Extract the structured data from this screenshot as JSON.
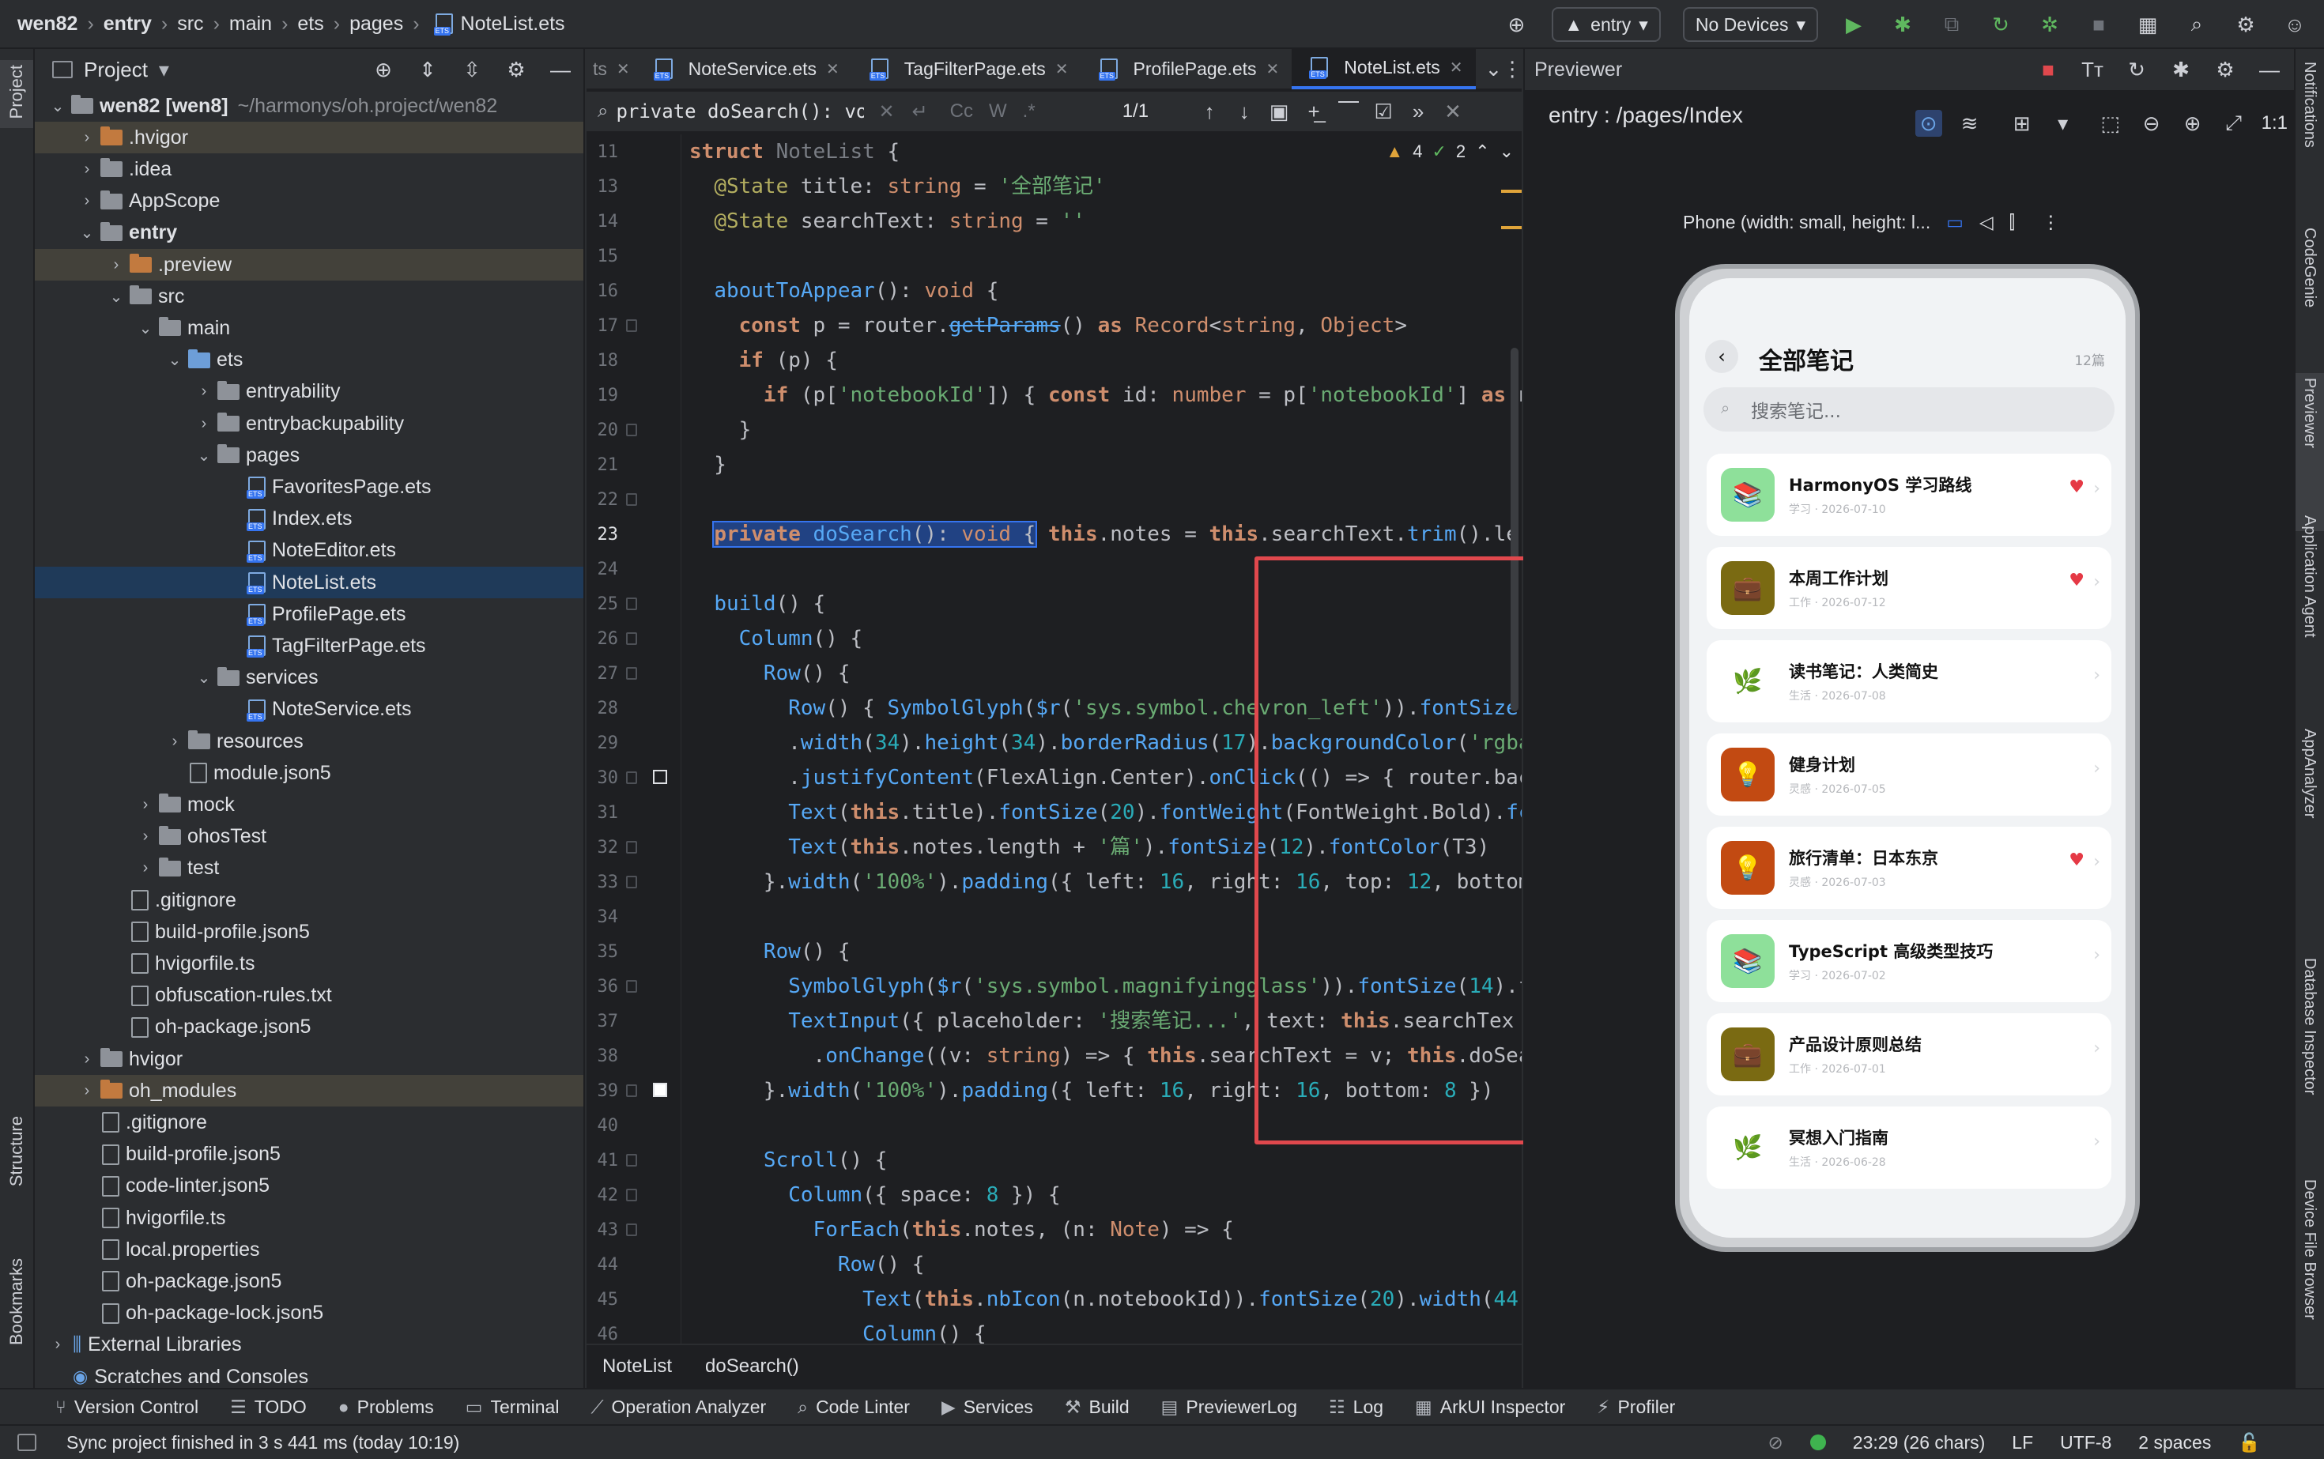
{
  "titlebar": {
    "project": "wen82",
    "path": [
      "entry",
      "src",
      "main",
      "ets",
      "pages"
    ],
    "file": "NoteList.ets",
    "run_config": "entry",
    "device": "No Devices"
  },
  "left_strip": {
    "project": "Project",
    "structure": "Structure",
    "bookmarks": "Bookmarks"
  },
  "project_panel": {
    "title": "Project",
    "items": [
      {
        "label": "wen82 [wen8]",
        "extra": "~/harmonys/oh.project/wen82",
        "depth": 0,
        "kind": "folder",
        "open": true
      },
      {
        "label": ".hvigor",
        "depth": 1,
        "kind": "folder-o",
        "open": false,
        "hl": true
      },
      {
        "label": ".idea",
        "depth": 1,
        "kind": "folder",
        "open": false
      },
      {
        "label": "AppScope",
        "depth": 1,
        "kind": "folder",
        "open": false
      },
      {
        "label": "entry",
        "depth": 1,
        "kind": "folder",
        "open": true,
        "bold": true
      },
      {
        "label": ".preview",
        "depth": 2,
        "kind": "folder-o",
        "open": false,
        "hl": true
      },
      {
        "label": "src",
        "depth": 2,
        "kind": "folder",
        "open": true
      },
      {
        "label": "main",
        "depth": 3,
        "kind": "folder",
        "open": true
      },
      {
        "label": "ets",
        "depth": 4,
        "kind": "folder-b",
        "open": true
      },
      {
        "label": "entryability",
        "depth": 5,
        "kind": "folder",
        "open": false
      },
      {
        "label": "entrybackupability",
        "depth": 5,
        "kind": "folder",
        "open": false
      },
      {
        "label": "pages",
        "depth": 5,
        "kind": "folder",
        "open": true
      },
      {
        "label": "FavoritesPage.ets",
        "depth": 6,
        "kind": "ets"
      },
      {
        "label": "Index.ets",
        "depth": 6,
        "kind": "ets"
      },
      {
        "label": "NoteEditor.ets",
        "depth": 6,
        "kind": "ets"
      },
      {
        "label": "NoteList.ets",
        "depth": 6,
        "kind": "ets",
        "sel": true
      },
      {
        "label": "ProfilePage.ets",
        "depth": 6,
        "kind": "ets"
      },
      {
        "label": "TagFilterPage.ets",
        "depth": 6,
        "kind": "ets"
      },
      {
        "label": "services",
        "depth": 5,
        "kind": "folder",
        "open": true
      },
      {
        "label": "NoteService.ets",
        "depth": 6,
        "kind": "ets"
      },
      {
        "label": "resources",
        "depth": 4,
        "kind": "folder",
        "open": false
      },
      {
        "label": "module.json5",
        "depth": 4,
        "kind": "file"
      },
      {
        "label": "mock",
        "depth": 3,
        "kind": "folder",
        "open": false
      },
      {
        "label": "ohosTest",
        "depth": 3,
        "kind": "folder",
        "open": false
      },
      {
        "label": "test",
        "depth": 3,
        "kind": "folder",
        "open": false
      },
      {
        "label": ".gitignore",
        "depth": 2,
        "kind": "file"
      },
      {
        "label": "build-profile.json5",
        "depth": 2,
        "kind": "file"
      },
      {
        "label": "hvigorfile.ts",
        "depth": 2,
        "kind": "file"
      },
      {
        "label": "obfuscation-rules.txt",
        "depth": 2,
        "kind": "file"
      },
      {
        "label": "oh-package.json5",
        "depth": 2,
        "kind": "file"
      },
      {
        "label": "hvigor",
        "depth": 1,
        "kind": "folder",
        "open": false
      },
      {
        "label": "oh_modules",
        "depth": 1,
        "kind": "folder-o",
        "open": false,
        "hl": true
      },
      {
        "label": ".gitignore",
        "depth": 1,
        "kind": "file"
      },
      {
        "label": "build-profile.json5",
        "depth": 1,
        "kind": "file"
      },
      {
        "label": "code-linter.json5",
        "depth": 1,
        "kind": "file"
      },
      {
        "label": "hvigorfile.ts",
        "depth": 1,
        "kind": "file"
      },
      {
        "label": "local.properties",
        "depth": 1,
        "kind": "file"
      },
      {
        "label": "oh-package.json5",
        "depth": 1,
        "kind": "file"
      },
      {
        "label": "oh-package-lock.json5",
        "depth": 1,
        "kind": "file"
      },
      {
        "label": "External Libraries",
        "depth": 0,
        "kind": "lib",
        "open": false
      },
      {
        "label": "Scratches and Consoles",
        "depth": 0,
        "kind": "scratch"
      }
    ]
  },
  "tabs": [
    {
      "label": "NoteService.ets",
      "active": false
    },
    {
      "label": "TagFilterPage.ets",
      "active": false
    },
    {
      "label": "ProfilePage.ets",
      "active": false
    },
    {
      "label": "NoteList.ets",
      "active": true
    }
  ],
  "tabs_truncated": "ts",
  "search": {
    "query": "private doSearch(): void {",
    "cc": "Cc",
    "w": "W",
    "star": ".*",
    "result": "1/1"
  },
  "inspection": {
    "warnings": "4",
    "checks": "2"
  },
  "code_lines": [
    {
      "n": "11",
      "h": "<span class='kw'>struct</span> <span class='dim'>NoteList</span> {"
    },
    {
      "n": "13",
      "h": "  <span class='anno'>@State</span> title: <span class='kw2'>string</span> = <span class='str'>'全部笔记'</span>"
    },
    {
      "n": "14",
      "h": "  <span class='anno'>@State</span> searchText: <span class='kw2'>string</span> = <span class='str'>''</span>"
    },
    {
      "n": "15",
      "h": ""
    },
    {
      "n": "16",
      "h": "  <span class='fn'>aboutToAppear</span>(): <span class='kw2'>void</span> {"
    },
    {
      "n": "17",
      "h": "    <span class='kw'>const</span> p = router.<span class='fn' style='text-decoration:line-through'>getParams</span>() <span class='kw'>as</span> <span class='kw2'>Record</span>&lt;<span class='kw2'>string</span>, <span class='kw2'>Object</span>&gt;"
    },
    {
      "n": "18",
      "h": "    <span class='kw'>if</span> (p) {"
    },
    {
      "n": "19",
      "h": "      <span class='kw'>if</span> (p[<span class='str'>'notebookId'</span>]) { <span class='kw'>const</span> id: <span class='kw2'>number</span> = p[<span class='str'>'notebookId'</span>] <span class='kw'>as</span> n"
    },
    {
      "n": "20",
      "h": "    }"
    },
    {
      "n": "21",
      "h": "  }"
    },
    {
      "n": "22",
      "h": ""
    },
    {
      "n": "23",
      "h": "  <span style='background:#214283;outline:2px solid #3574f0'><span class='kw'>private</span> <span class='fn'>doSearch</span>(): <span class='kw2'>void</span> {</span> <span class='kw'>this</span>.notes = <span class='kw'>this</span>.searchText.<span class='fn'>trim</span>().ler"
    },
    {
      "n": "24",
      "h": ""
    },
    {
      "n": "25",
      "h": "  <span class='fn'>build</span>() {"
    },
    {
      "n": "26",
      "h": "    <span class='fn'>Column</span>() {"
    },
    {
      "n": "27",
      "h": "      <span class='fn'>Row</span>() {"
    },
    {
      "n": "28",
      "h": "        <span class='fn'>Row</span>() { <span class='fn'>SymbolGlyph</span>(<span class='fn'>$r</span>(<span class='str'>'sys.symbol.chevron_left'</span>)).<span class='fn'>fontSize</span>("
    },
    {
      "n": "29",
      "h": "        .<span class='fn'>width</span>(<span class='num'>34</span>).<span class='fn'>height</span>(<span class='num'>34</span>).<span class='fn'>borderRadius</span>(<span class='num'>17</span>).<span class='fn'>backgroundColor</span>(<span class='str'>'rgba</span>"
    },
    {
      "n": "30",
      "h": "        .<span class='fn'>justifyContent</span>(FlexAlign.Center).<span class='fn'>onClick</span>(() =&gt; { router.bac"
    },
    {
      "n": "31",
      "h": "        <span class='fn'>Text</span>(<span class='kw'>this</span>.title).<span class='fn'>fontSize</span>(<span class='num'>20</span>).<span class='fn'>fontWeight</span>(FontWeight.Bold).<span class='fn'>fc</span>"
    },
    {
      "n": "32",
      "h": "        <span class='fn'>Text</span>(<span class='kw'>this</span>.notes.length + <span class='str'>'篇'</span>).<span class='fn'>fontSize</span>(<span class='num'>12</span>).<span class='fn'>fontColor</span>(T3)"
    },
    {
      "n": "33",
      "h": "      }.<span class='fn'>width</span>(<span class='str'>'100%'</span>).<span class='fn'>padding</span>({ left: <span class='num'>16</span>, right: <span class='num'>16</span>, top: <span class='num'>12</span>, bottom"
    },
    {
      "n": "34",
      "h": ""
    },
    {
      "n": "35",
      "h": "      <span class='fn'>Row</span>() {"
    },
    {
      "n": "36",
      "h": "        <span class='fn'>SymbolGlyph</span>(<span class='fn'>$r</span>(<span class='str'>'sys.symbol.magnifyingglass'</span>)).<span class='fn'>fontSize</span>(<span class='num'>14</span>).f"
    },
    {
      "n": "37",
      "h": "        <span class='fn'>TextInput</span>({ placeholder: <span class='str'>'搜索笔记...'</span>, text: <span class='kw'>this</span>.searchTex"
    },
    {
      "n": "38",
      "h": "          .<span class='fn'>onChange</span>((v: <span class='kw2'>string</span>) =&gt; { <span class='kw'>this</span>.searchText = v; <span class='kw'>this</span>.doSea"
    },
    {
      "n": "39",
      "h": "      }.<span class='fn'>width</span>(<span class='str'>'100%'</span>).<span class='fn'>padding</span>({ left: <span class='num'>16</span>, right: <span class='num'>16</span>, bottom: <span class='num'>8</span> })"
    },
    {
      "n": "40",
      "h": ""
    },
    {
      "n": "41",
      "h": "      <span class='fn'>Scroll</span>() {"
    },
    {
      "n": "42",
      "h": "        <span class='fn'>Column</span>({ space: <span class='num'>8</span> }) {"
    },
    {
      "n": "43",
      "h": "          <span class='fn'>ForEach</span>(<span class='kw'>this</span>.notes, (n: <span class='kw2'>Note</span>) =&gt; {"
    },
    {
      "n": "44",
      "h": "            <span class='fn'>Row</span>() {"
    },
    {
      "n": "45",
      "h": "              <span class='fn'>Text</span>(<span class='kw'>this</span>.<span class='fn'>nbIcon</span>(n.notebookId)).<span class='fn'>fontSize</span>(<span class='num'>20</span>).<span class='fn'>width</span>(<span class='num'>44</span>)"
    },
    {
      "n": "46",
      "h": "              <span class='fn'>Column</span>() {"
    }
  ],
  "editor_crumbs": [
    "NoteList",
    "doSearch()"
  ],
  "previewer": {
    "title": "Previewer",
    "route": "entry : /pages/Index",
    "device_label": "Phone (width: small, height: l...",
    "ratio": "1:1"
  },
  "phone": {
    "title": "全部笔记",
    "count": "12篇",
    "search_placeholder": "搜索笔记...",
    "notes": [
      {
        "title": "HarmonyOS 学习路线",
        "meta": "学习 · 2026-07-10",
        "icon": "📚",
        "bg": "#8ee09a",
        "fav": true
      },
      {
        "title": "本周工作计划",
        "meta": "工作 · 2026-07-12",
        "icon": "💼",
        "bg": "#7a6a12",
        "fav": true
      },
      {
        "title": "读书笔记：人类简史",
        "meta": "生活 · 2026-07-08",
        "icon": "🌿",
        "bg": "#ffffff",
        "fav": false
      },
      {
        "title": "健身计划",
        "meta": "灵感 · 2026-07-05",
        "icon": "💡",
        "bg": "#c24a12",
        "fav": false
      },
      {
        "title": "旅行清单：日本东京",
        "meta": "灵感 · 2026-07-03",
        "icon": "💡",
        "bg": "#c24a12",
        "fav": true
      },
      {
        "title": "TypeScript 高级类型技巧",
        "meta": "学习 · 2026-07-02",
        "icon": "📚",
        "bg": "#8ee09a",
        "fav": false
      },
      {
        "title": "产品设计原则总结",
        "meta": "工作 · 2026-07-01",
        "icon": "💼",
        "bg": "#7a6a12",
        "fav": false
      },
      {
        "title": "冥想入门指南",
        "meta": "生活 · 2026-06-28",
        "icon": "🌿",
        "bg": "#ffffff",
        "fav": false
      }
    ]
  },
  "right_strip": [
    "Notifications",
    "CodeGenie",
    "Previewer",
    "Application Agent",
    "AppAnalyzer",
    "Database Inspector",
    "Device File Browser"
  ],
  "toolwindows": [
    "Version Control",
    "TODO",
    "Problems",
    "Terminal",
    "Operation Analyzer",
    "Code Linter",
    "Services",
    "Build",
    "PreviewerLog",
    "Log",
    "ArkUI Inspector",
    "Profiler"
  ],
  "status": {
    "message": "Sync project finished in 3 s 441 ms (today 10:19)",
    "position": "23:29 (26 chars)",
    "line_sep": "LF",
    "encoding": "UTF-8",
    "indent": "2 spaces"
  }
}
